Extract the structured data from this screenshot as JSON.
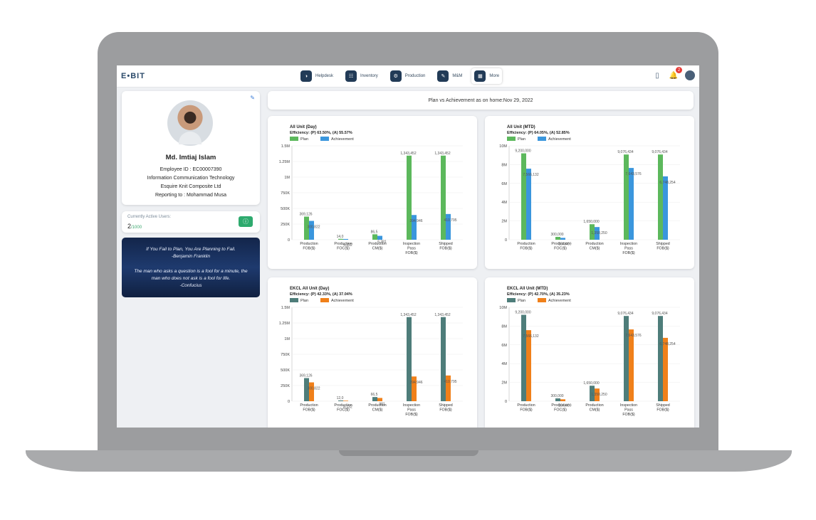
{
  "app": {
    "logo": "E•BIT",
    "nav": [
      {
        "label": "Helpdesk",
        "icon": "helpdesk-icon",
        "glyph": "◑"
      },
      {
        "label": "Inventory",
        "icon": "inventory-icon",
        "glyph": "☷"
      },
      {
        "label": "Production",
        "icon": "production-icon",
        "glyph": "⚙"
      },
      {
        "label": "M&M",
        "icon": "mm-icon",
        "glyph": "✎"
      },
      {
        "label": "More",
        "icon": "more-icon",
        "glyph": "▦"
      }
    ],
    "notification_count": "2"
  },
  "profile": {
    "name": "Md. Imtiaj Islam",
    "employee_id": "Employee ID : EC00007390",
    "department": "Information Communication Technology",
    "company": "Esquire Knit Composite Ltd",
    "reporting": "Reporting to : Mohammad Musa"
  },
  "users": {
    "label": "Currently Active Users:",
    "count": "2",
    "max": "/1000"
  },
  "quotes": {
    "q1": "If You Fail to Plan, You Are Planning to Fail.",
    "a1": "-Benjamin Franklin",
    "q2a": "The man who asks a question is a fool for a minute, the",
    "q2b": "man who does not ask is a fool for life.",
    "a2": "-Confucius"
  },
  "plan_header": "Plan vs Achievement as on home:Nov 29, 2022",
  "colors": {
    "plan_green": "#5cb85c",
    "achievement_blue": "#3a96dd",
    "plan_teal": "#4e7d7a",
    "achievement_orange": "#f0801a"
  },
  "chart_data": [
    {
      "type": "bar",
      "title": "All Unit (Day)",
      "subtitle": "Efficiency: (P) 63.50%, (A) 55.57%",
      "categories": [
        "Production\nFOB($)",
        "Production\nFOC($)",
        "Production\nCM($)",
        "Inspection\nPass\nFOB($)",
        "Shipped\nFOB($)"
      ],
      "series": [
        {
          "name": "Plan",
          "values": [
            369126,
            14000,
            86500,
            1343452,
            1343452
          ],
          "labels": [
            "369,126",
            "14,0",
            "86,5",
            "1,343,452",
            "1,343,452"
          ]
        },
        {
          "name": "Achievement",
          "values": [
            300822,
            12000,
            62000,
            394946,
            410795
          ],
          "labels": [
            "300,822",
            "4,832",
            "6,381",
            "394,946",
            "410,795"
          ]
        }
      ],
      "ylim": [
        0,
        1500000
      ],
      "yticks": [
        "0",
        "250K",
        "500K",
        "750K",
        "1M",
        "1.25M",
        "1.5M"
      ],
      "colors": [
        "#5cb85c",
        "#3a96dd"
      ]
    },
    {
      "type": "bar",
      "title": "All Unit (MTD)",
      "subtitle": "Efficiency: (P) 64.05%, (A) 52.85%",
      "categories": [
        "Production\nFOB($)",
        "Production\nFOC($)",
        "Production\nCM($)",
        "Inspection\nPass\nFOB($)",
        "Shipped\nFOB($)"
      ],
      "series": [
        {
          "name": "Plan",
          "values": [
            9200000,
            300000,
            1650000,
            9076434,
            9076434
          ],
          "labels": [
            "9,200,000",
            "300,000",
            "1,650,000",
            "9,076,434",
            "9,076,434"
          ]
        },
        {
          "name": "Achievement",
          "values": [
            7566132,
            200000,
            1350250,
            7643576,
            6748254
          ],
          "labels": [
            "7,566,132",
            "204,409",
            "1,350,250",
            "7,643,576",
            "6,748,254"
          ]
        }
      ],
      "ylim": [
        0,
        10000000
      ],
      "yticks": [
        "0",
        "2M",
        "4M",
        "6M",
        "8M",
        "10M"
      ],
      "colors": [
        "#5cb85c",
        "#3a96dd"
      ]
    },
    {
      "type": "bar",
      "title": "EKCL All Unit (Day)",
      "subtitle": "Efficiency: (P) 42.33%, (A) 37.04%",
      "categories": [
        "Production\nFOB($)",
        "Production\nFOC($)",
        "Production\nCM($)",
        "Inspection\nPass\nFOB($)",
        "Shipped\nFOB($)"
      ],
      "series": [
        {
          "name": "Plan",
          "values": [
            369126,
            12000,
            66500,
            1343452,
            1343452
          ],
          "labels": [
            "369,126",
            "12,0",
            "66,5",
            "1,343,452",
            "1,343,452"
          ]
        },
        {
          "name": "Achievement",
          "values": [
            300822,
            8132,
            52000,
            394946,
            410795
          ],
          "labels": [
            "300,822",
            "8,132",
            "981",
            "394,946",
            "410,795"
          ]
        }
      ],
      "ylim": [
        0,
        1500000
      ],
      "yticks": [
        "0",
        "250K",
        "500K",
        "750K",
        "1M",
        "1.25M",
        "1.5M"
      ],
      "colors": [
        "#4e7d7a",
        "#f0801a"
      ]
    },
    {
      "type": "bar",
      "title": "EKCL All Unit (MTD)",
      "subtitle": "Efficiency: (P) 42.70%, (A) 35.23%",
      "categories": [
        "Production\nFOB($)",
        "Production\nFOC($)",
        "Production\nCM($)",
        "Inspection\nPass\nFOB($)",
        "Shipped\nFOB($)"
      ],
      "series": [
        {
          "name": "Plan",
          "values": [
            9200000,
            300000,
            1650000,
            9076434,
            9076434
          ],
          "labels": [
            "9,200,000",
            "300,000",
            "1,650,000",
            "9,076,434",
            "9,076,434"
          ]
        },
        {
          "name": "Achievement",
          "values": [
            7566132,
            204409,
            1350250,
            7643576,
            6748254
          ],
          "labels": [
            "7,566,132",
            "204,409",
            "1,350,250",
            "7,643,576",
            "6,748,254"
          ]
        }
      ],
      "ylim": [
        0,
        10000000
      ],
      "yticks": [
        "0",
        "2M",
        "4M",
        "6M",
        "8M",
        "10M"
      ],
      "colors": [
        "#4e7d7a",
        "#f0801a"
      ]
    }
  ]
}
